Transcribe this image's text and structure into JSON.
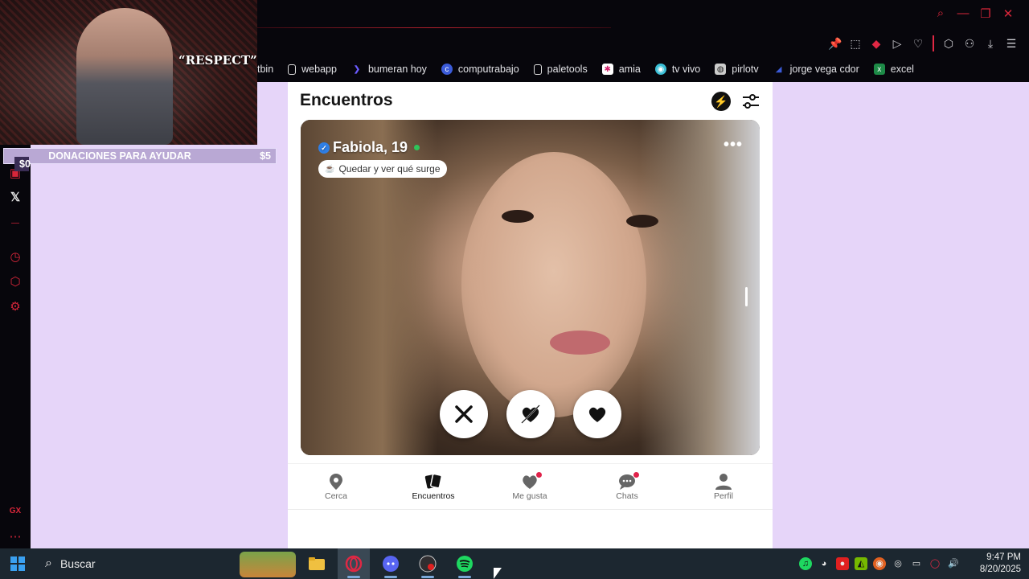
{
  "browser": {
    "bookmarks": [
      {
        "label": "tbin",
        "icon": "none"
      },
      {
        "label": "webapp",
        "icon": "doc"
      },
      {
        "label": "bumeran hoy",
        "icon": "arrow"
      },
      {
        "label": "computrabajo",
        "icon": "blue"
      },
      {
        "label": "paletools",
        "icon": "doc"
      },
      {
        "label": "amia",
        "icon": "pink"
      },
      {
        "label": "tv vivo",
        "icon": "teal"
      },
      {
        "label": "pirlotv",
        "icon": "gray"
      },
      {
        "label": "jorge vega cdor",
        "icon": "navy"
      },
      {
        "label": "excel",
        "icon": "green"
      }
    ]
  },
  "overlay": {
    "caption": "“RESPECT”",
    "donation": {
      "start": "$0",
      "label": "DONACIONES PARA AYUDAR",
      "goal": "$5"
    }
  },
  "app": {
    "title": "Encuentros",
    "profile": {
      "name": "Fabiola, 19",
      "verified": true,
      "online": true,
      "chip": "Quedar y ver qué surge"
    },
    "actions": [
      "dislike",
      "superlike",
      "like"
    ],
    "nav": [
      {
        "label": "Cerca",
        "icon": "location-pin-icon"
      },
      {
        "label": "Encuentros",
        "icon": "cards-icon",
        "active": true
      },
      {
        "label": "Me gusta",
        "icon": "heart-badge-icon",
        "badge": true
      },
      {
        "label": "Chats",
        "icon": "chat-icon",
        "badge": true
      },
      {
        "label": "Perfil",
        "icon": "person-icon"
      }
    ]
  },
  "taskbar": {
    "search_label": "Buscar",
    "time": "9:47 PM",
    "date": "8/20/2025"
  },
  "colors": {
    "accent_red": "#d8263a",
    "background_lavender": "#e6d5f9",
    "online": "#2fc45a",
    "badge": "#e0224a"
  }
}
